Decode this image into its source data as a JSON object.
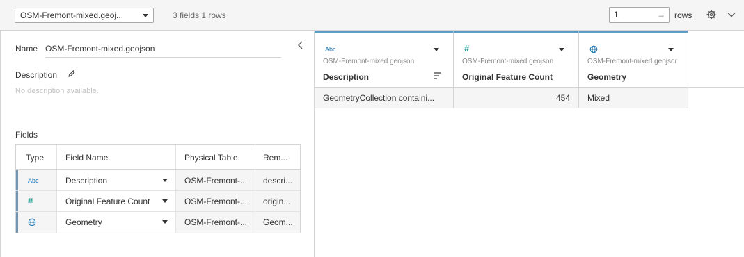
{
  "toolbar": {
    "datasource_selected": "OSM-Fremont-mixed.geoj...",
    "field_summary": "3 fields 1 rows",
    "rows_value": "1",
    "rows_label": "rows"
  },
  "icons": {
    "gear": "gear-icon",
    "chevron": "chevron-down-icon",
    "collapse": "chevron-left-icon",
    "edit": "pencil-icon",
    "string_type": "Abc",
    "number_type": "#",
    "geo_type": "globe-icon",
    "sort": "sort-icon"
  },
  "details": {
    "name_label": "Name",
    "name_value": "OSM-Fremont-mixed.geojson",
    "description_label": "Description",
    "description_placeholder": "No description available.",
    "fields_label": "Fields"
  },
  "fields_table": {
    "headers": [
      "Type",
      "Field Name",
      "Physical Table",
      "Rem..."
    ],
    "rows": [
      {
        "type_glyph": "Abc",
        "field_name": "Description",
        "physical_table": "OSM-Fremont-...",
        "remote": "descri..."
      },
      {
        "type_glyph": "#",
        "field_name": "Original Feature Count",
        "physical_table": "OSM-Fremont-...",
        "remote": "origin..."
      },
      {
        "type_glyph": "globe",
        "field_name": "Geometry",
        "physical_table": "OSM-Fremont-...",
        "remote": "Geom..."
      }
    ]
  },
  "grid": {
    "columns": [
      {
        "type_glyph": "Abc",
        "source": "OSM-Fremont-mixed.geojson",
        "name": "Description"
      },
      {
        "type_glyph": "#",
        "source": "OSM-Fremont-mixed.geojson",
        "name": "Original Feature Count"
      },
      {
        "type_glyph": "globe",
        "source": "OSM-Fremont-mixed.geojsor",
        "name": "Geometry"
      }
    ],
    "rows": [
      [
        "GeometryCollection containi...",
        "454",
        "Mixed"
      ]
    ]
  },
  "colors": {
    "accent": "#5b9dc4",
    "field_marker": "#6f95b5",
    "string_icon": "#1f77b4",
    "number_icon": "#2aa198",
    "geo_icon": "#1f77b4"
  }
}
